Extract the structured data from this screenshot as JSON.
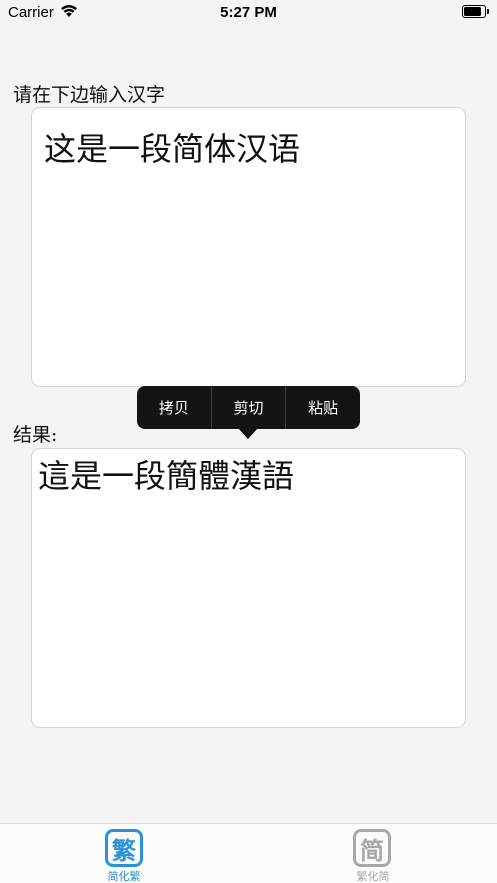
{
  "status_bar": {
    "carrier": "Carrier",
    "time": "5:27 PM",
    "wifi_icon": "wifi-icon",
    "battery_icon": "battery-icon"
  },
  "input": {
    "label": "请在下边输入汉字",
    "value": "这是一段简体汉语"
  },
  "context_menu": {
    "items": [
      "拷贝",
      "剪切",
      "粘贴"
    ]
  },
  "result": {
    "label": "结果:",
    "value": "這是一段簡體漢語"
  },
  "tabs": [
    {
      "icon_char": "繁",
      "label": "简化繁",
      "selected": true,
      "color": "#2b92d6"
    },
    {
      "icon_char": "简",
      "label": "繁化简",
      "selected": false,
      "color": "#a8a8a8"
    }
  ]
}
